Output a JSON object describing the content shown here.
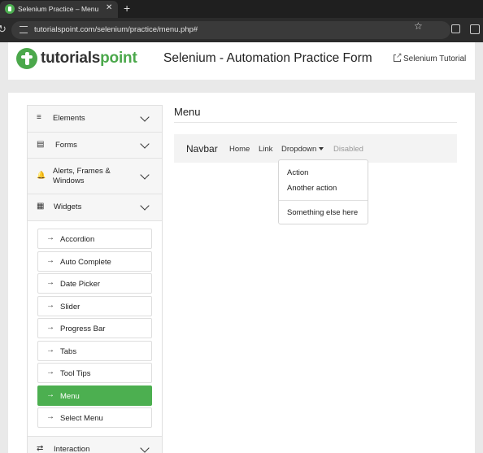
{
  "browser": {
    "tab_title": "Selenium Practice – Menu",
    "tab_close": "✕",
    "new_tab": "+",
    "url": "tutorialspoint.com/selenium/practice/menu.php#",
    "icons": [
      "reload-icon",
      "site-info-icon",
      "star-icon",
      "extensions-icon",
      "side-panel-icon"
    ]
  },
  "header": {
    "logo_main": "tutorials",
    "logo_accent": "point",
    "title": "Selenium - Automation Practice Form",
    "link": "Selenium Tutorial",
    "accent_color": "#4ba84b"
  },
  "sidebar": {
    "sections": [
      {
        "icon": "≡",
        "label": "Elements"
      },
      {
        "icon": "▤",
        "label": "Forms"
      },
      {
        "icon": "🔔",
        "label": "Alerts, Frames & Windows"
      },
      {
        "icon": "▦",
        "label": "Widgets"
      },
      {
        "icon": "⇄",
        "label": "Interaction"
      }
    ],
    "widgets": [
      {
        "label": "Accordion"
      },
      {
        "label": "Auto Complete"
      },
      {
        "label": "Date Picker"
      },
      {
        "label": "Slider"
      },
      {
        "label": "Progress Bar"
      },
      {
        "label": "Tabs"
      },
      {
        "label": "Tool Tips"
      },
      {
        "label": "Menu",
        "active": true
      },
      {
        "label": "Select Menu"
      }
    ],
    "active_color": "#4caf50"
  },
  "content": {
    "title": "Menu",
    "navbar": {
      "brand": "Navbar",
      "links": [
        "Home",
        "Link",
        "Dropdown",
        "Disabled"
      ]
    },
    "dropdown": {
      "items": [
        "Action",
        "Another action"
      ],
      "extra": "Something else here"
    }
  }
}
